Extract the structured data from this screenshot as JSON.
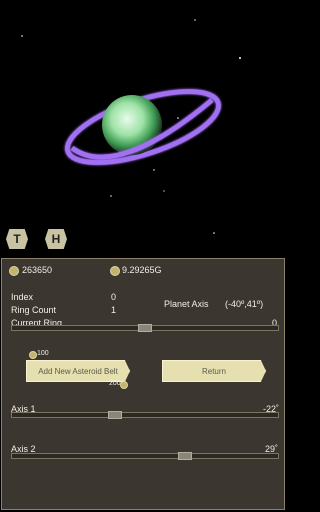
{
  "top_buttons": {
    "left": "T",
    "right": "H"
  },
  "stats": {
    "money": "263650",
    "mass": "9.29265G"
  },
  "info": {
    "index_label": "Index",
    "index_value": "0",
    "ring_count_label": "Ring Count",
    "ring_count_value": "1",
    "planet_axis_label": "Planet Axis",
    "planet_axis_value": "(-40º,41º)"
  },
  "current_ring": {
    "label": "Current Ring",
    "value": "0",
    "slider_level": 0.5
  },
  "actions": {
    "cost_top": "100",
    "add_label": "Add New Asteroid Belt",
    "cost_bottom": "200",
    "return_label": "Return"
  },
  "axis1": {
    "label": "Axis 1",
    "value": "-22˚",
    "slider_level": 0.38
  },
  "axis2": {
    "label": "Axis 2",
    "value": "29˚",
    "slider_level": 0.66
  },
  "colors": {
    "panel_bg": "#3b3630",
    "panel_border": "#8d8264",
    "button_fill": "#e6dfb0",
    "planet": "#7ad78a",
    "ring": "#a16ff3"
  }
}
